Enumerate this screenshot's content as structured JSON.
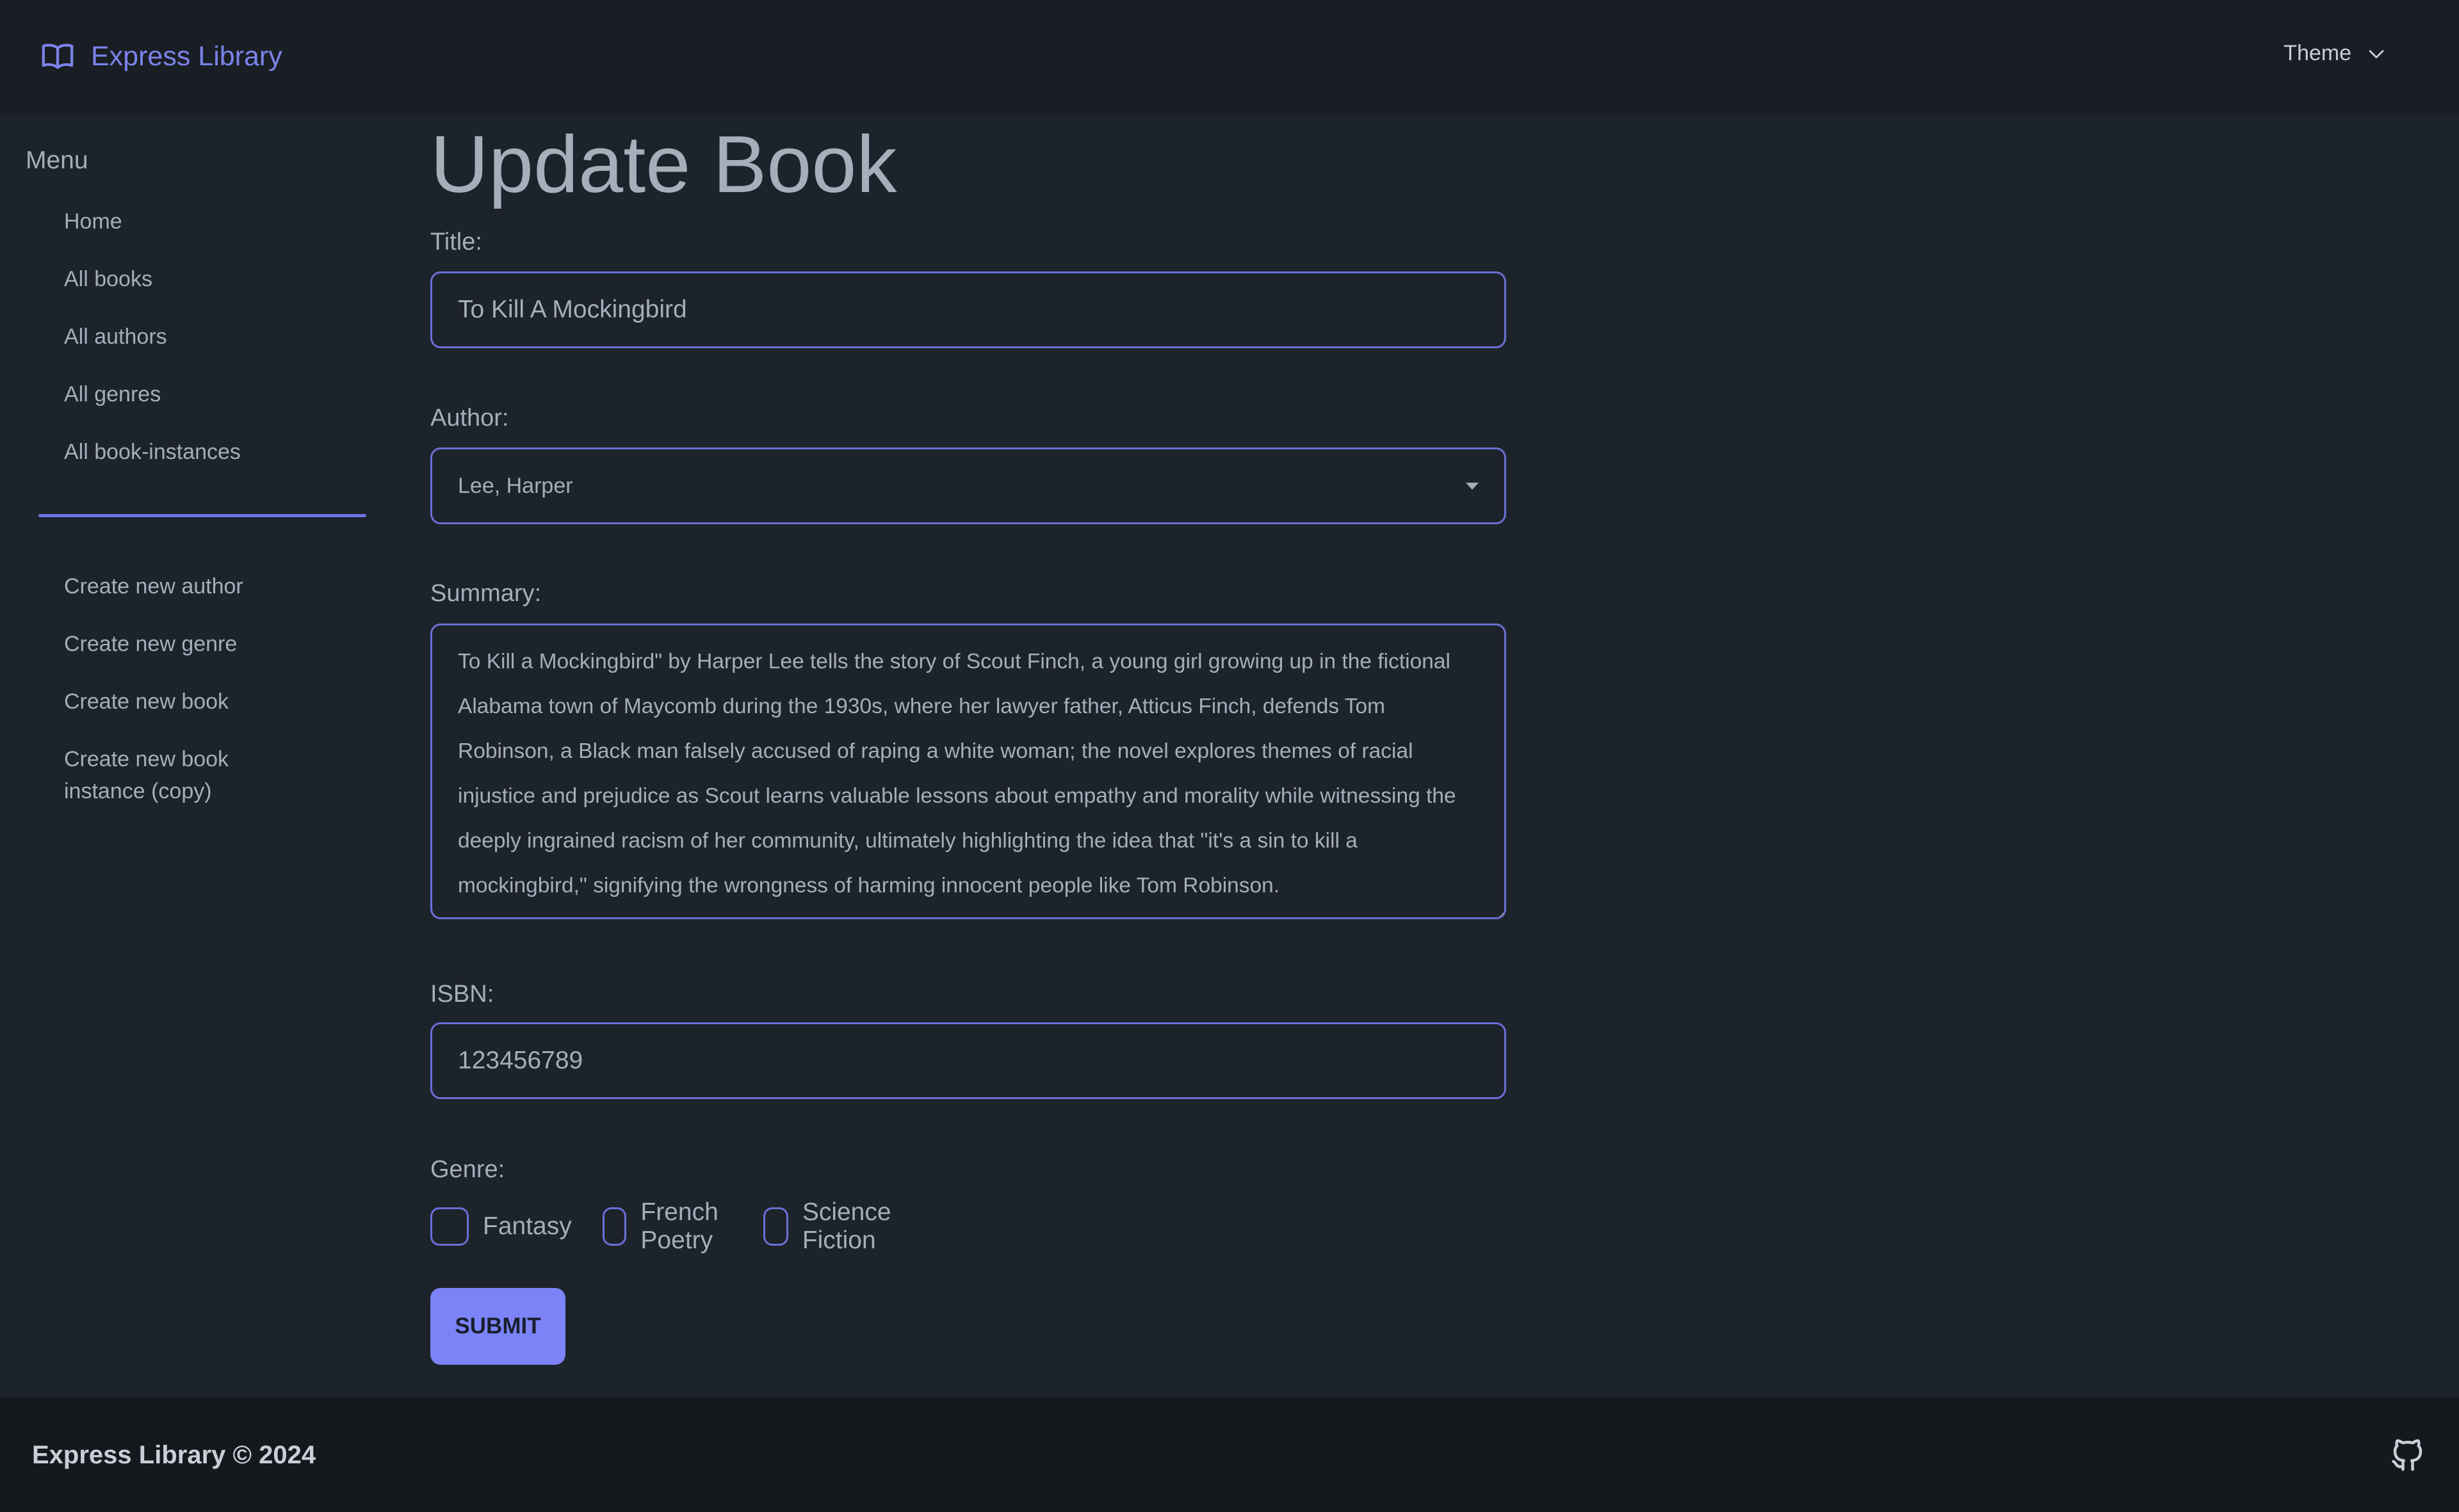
{
  "navbar": {
    "brand_label": "Express Library",
    "brand_icon": "open-book-icon",
    "theme_label": "Theme",
    "theme_icon": "chevron-down-icon"
  },
  "sidebar": {
    "menu_title": "Menu",
    "items": [
      {
        "label": "Home"
      },
      {
        "label": "All books"
      },
      {
        "label": "All authors"
      },
      {
        "label": "All genres"
      },
      {
        "label": "All book-instances"
      }
    ],
    "create_items": [
      {
        "label": "Create new author"
      },
      {
        "label": "Create new genre"
      },
      {
        "label": "Create new book"
      },
      {
        "label": "Create new book instance (copy)"
      }
    ]
  },
  "form": {
    "page_title": "Update Book",
    "title_label": "Title:",
    "title_value": "To Kill A Mockingbird",
    "author_label": "Author:",
    "author_value": "Lee, Harper",
    "summary_label": "Summary:",
    "summary_value": "To Kill a Mockingbird\" by Harper Lee tells the story of Scout Finch, a young girl growing up in the fictional Alabama town of Maycomb during the 1930s, where her lawyer father, Atticus Finch, defends Tom Robinson, a Black man falsely accused of raping a white woman; the novel explores themes of racial injustice and prejudice as Scout learns valuable lessons about empathy and morality while witnessing the deeply ingrained racism of her community, ultimately highlighting the idea that \"it's a sin to kill a mockingbird,\" signifying the wrongness of harming innocent people like Tom Robinson.",
    "isbn_label": "ISBN:",
    "isbn_value": "123456789",
    "genre_label": "Genre:",
    "genres": [
      {
        "label": "Fantasy",
        "checked": false
      },
      {
        "label": "French Poetry",
        "checked": false
      },
      {
        "label": "Science Fiction",
        "checked": false
      }
    ],
    "submit_label": "SUBMIT"
  },
  "footer": {
    "text": "Express Library © 2024",
    "icon": "github-icon"
  },
  "colors": {
    "accent": "#7b83f7",
    "background": "#1d232a",
    "navbar": "#191e24",
    "footer": "#15191e"
  }
}
